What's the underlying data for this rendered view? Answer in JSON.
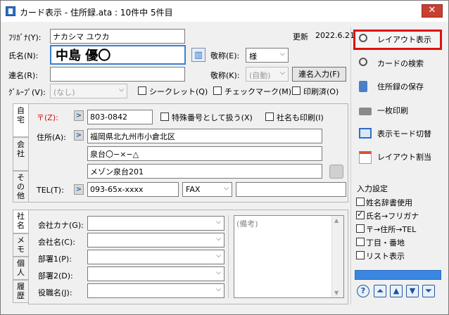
{
  "window": {
    "title": "カード表示 - 住所録.ata : 10件中 5件目",
    "close": "✕"
  },
  "header": {
    "update_label": "更新",
    "update_date": "2022.6.21"
  },
  "person": {
    "furigana_label": "ﾌﾘｶﾞﾅ(Y):",
    "furigana_value": "ナカシマ ユウカ",
    "name_label": "氏名(N):",
    "name_value": "中島 優〇",
    "honorific_label": "敬称(E):",
    "honorific_value": "様",
    "joint_label": "連名(R):",
    "joint_value": "",
    "joint_honorific_label": "敬称(K):",
    "joint_honorific_value": "(自動)",
    "joint_input_button": "連名入力(F)",
    "group_label": "ｸﾞﾙｰﾌﾟ(V):",
    "group_value": "(なし)",
    "secret_label": "シークレット(Q)",
    "checkmark_label": "チェックマーク(M)",
    "printed_label": "印刷済(O)"
  },
  "address_tabs": [
    "自宅",
    "会社",
    "その他"
  ],
  "home": {
    "zip_label": "〒(Z):",
    "zip_value": "803-0842",
    "special_label": "特殊番号として扱う(X)",
    "company_print_label": "社名も印刷(I)",
    "address_label": "住所(A):",
    "address1": "福岡県北九州市小倉北区",
    "address2": "泉台〇−×−△",
    "address3": "メゾン泉台201",
    "tel_label": "TEL(T):",
    "tel_value": "093-65x-xxxx",
    "fax_type": "FAX",
    "fax_value": ""
  },
  "company_tabs": [
    "社名",
    "メモ",
    "個人",
    "履歴"
  ],
  "company": {
    "kana_label": "会社カナ(G):",
    "name_label": "会社名(C):",
    "dept1_label": "部署1(P):",
    "dept2_label": "部署2(D):",
    "title_label": "役職名(J):",
    "memo_placeholder": "(備考)"
  },
  "sidebar": {
    "buttons": [
      "レイアウト表示",
      "カードの検索",
      "住所録の保存",
      "一枚印刷",
      "表示モード切替",
      "レイアウト割当"
    ],
    "input_settings_label": "入力設定",
    "options": [
      {
        "label": "姓名辞書使用",
        "checked": false
      },
      {
        "label": "氏名→フリガナ",
        "checked": true
      },
      {
        "label": "〒→住所→TEL",
        "checked": false
      },
      {
        "label": "丁目・番地",
        "checked": false
      },
      {
        "label": "リスト表示",
        "checked": false
      }
    ],
    "progress_percent": 100,
    "nav": [
      "?",
      "⏶",
      "▲",
      "▼",
      "⏷"
    ]
  },
  "colors": {
    "highlight": "#e01010",
    "accent": "#2f6fc4",
    "zip_red": "#d01010"
  }
}
